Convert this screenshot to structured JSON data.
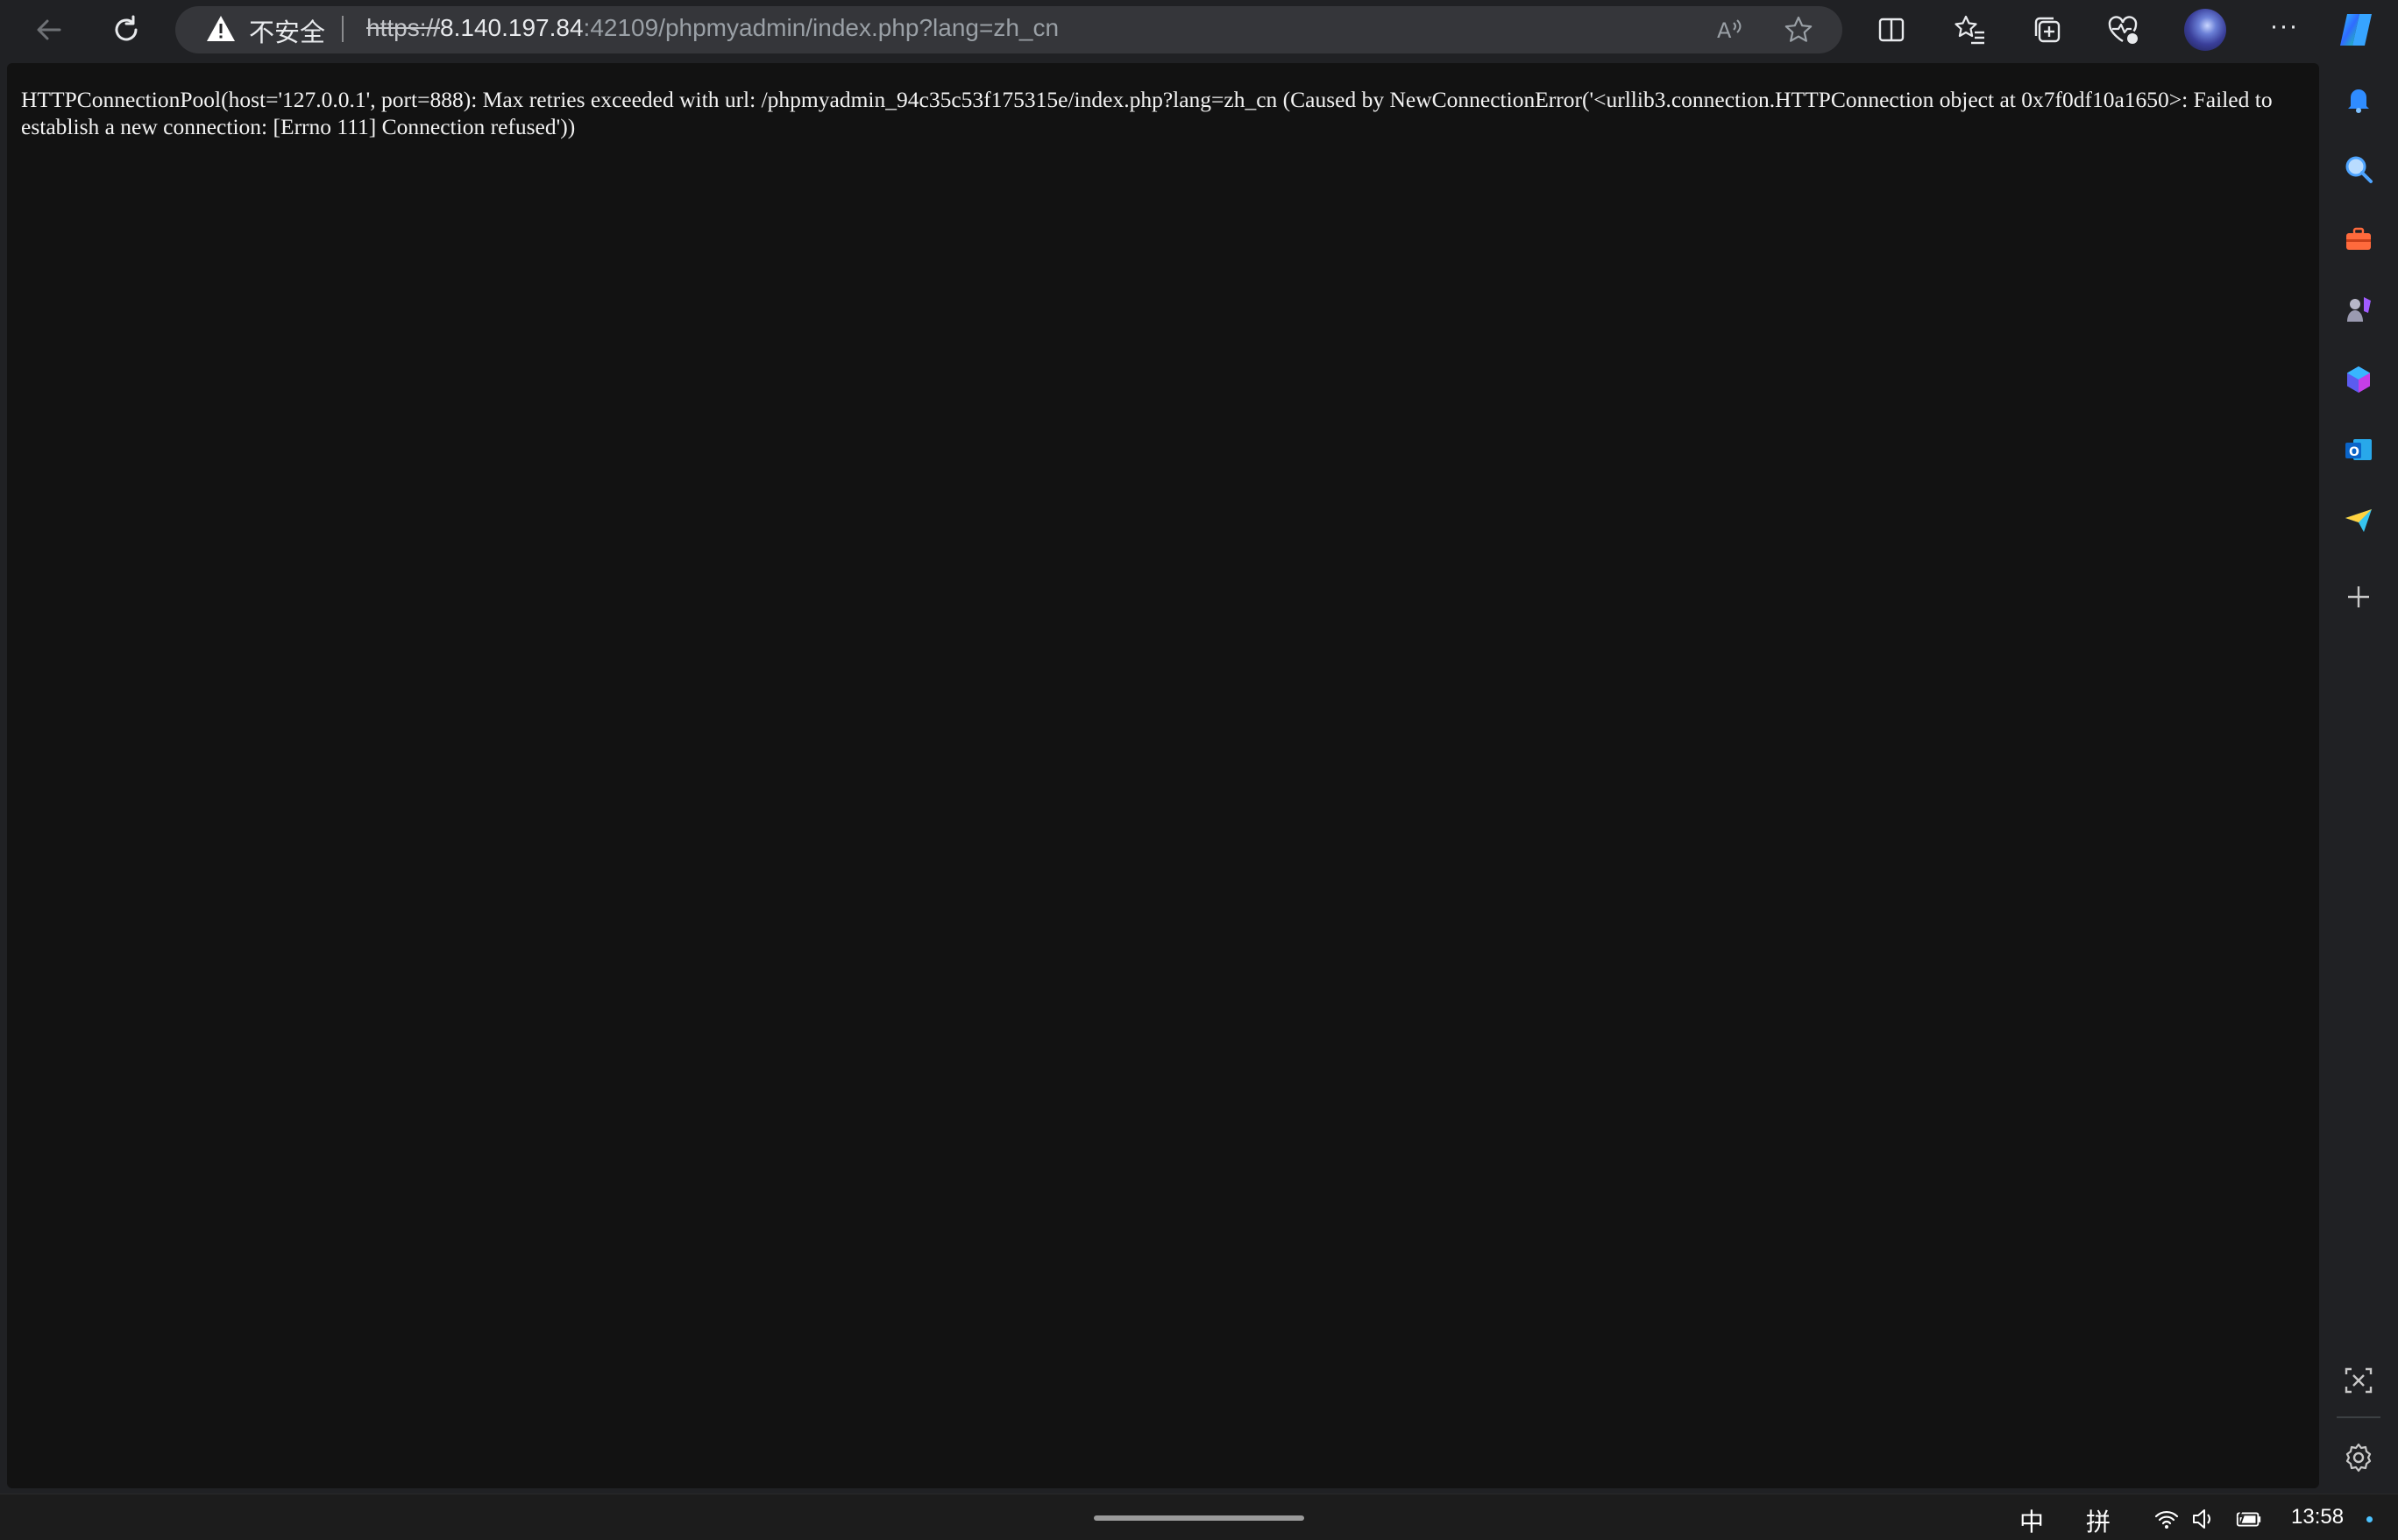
{
  "browser": {
    "security_label": "不安全",
    "url": {
      "scheme": "https://",
      "host": "8.140.197.84",
      "rest": ":42109/phpmyadmin/index.php?lang=zh_cn"
    },
    "icons": {
      "back": "back-arrow-icon",
      "refresh": "refresh-icon",
      "warning": "warning-icon",
      "read_aloud": "read-aloud-icon",
      "favorite": "star-icon",
      "split_screen": "split-screen-icon",
      "favorites": "favorites-icon",
      "collections": "collections-icon",
      "browser_essentials": "heart-pulse-icon",
      "profile": "avatar",
      "more": "more-icon",
      "copilot": "copilot-icon"
    },
    "more_label": "···"
  },
  "page": {
    "error_message": "HTTPConnectionPool(host='127.0.0.1', port=888): Max retries exceeded with url: /phpmyadmin_94c35c53f175315e/index.php?lang=zh_cn (Caused by NewConnectionError('<urllib3.connection.HTTPConnection object at 0x7f0df10a1650>: Failed to establish a new connection: [Errno 111] Connection refused'))"
  },
  "sidebar": {
    "items": [
      "bell-icon",
      "search-icon",
      "toolbox-icon",
      "games-icon",
      "microsoft365-icon",
      "outlook-icon",
      "send-icon",
      "plus-icon"
    ],
    "bottom": [
      "screenshot-icon",
      "settings-icon"
    ]
  },
  "taskbar": {
    "ime_mode": "中",
    "ime_layout": "拼",
    "clock": "13:58",
    "icons": [
      "wifi-icon",
      "volume-icon",
      "battery-icon"
    ]
  },
  "colors": {
    "page_bg": "#121212",
    "chrome_bg": "#202124",
    "accent": "#4cc2ff"
  }
}
